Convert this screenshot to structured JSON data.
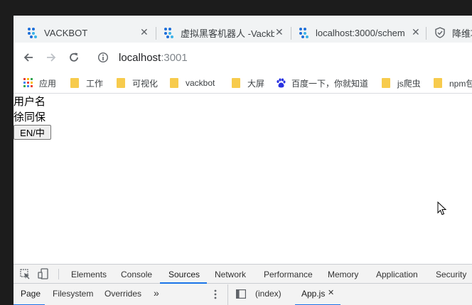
{
  "tabs": [
    {
      "title": "VACKBOT",
      "icon": "vackbot-favicon"
    },
    {
      "title": "虚拟黑客机器人 -Vackbot",
      "icon": "vackbot-favicon"
    },
    {
      "title": "localhost:3000/schem",
      "icon": "vackbot-favicon"
    },
    {
      "title": "降维攻",
      "icon": "shield-favicon"
    }
  ],
  "address": {
    "host": "localhost",
    "port": ":3001"
  },
  "bookmarks": [
    {
      "label": "应用",
      "icon": "apps-grid-icon"
    },
    {
      "label": "工作",
      "icon": "folder-icon"
    },
    {
      "label": "可视化",
      "icon": "folder-icon"
    },
    {
      "label": "vackbot",
      "icon": "folder-icon"
    },
    {
      "label": "大屏",
      "icon": "folder-icon"
    },
    {
      "label": "百度一下，你就知道",
      "icon": "baidu-paw-icon"
    },
    {
      "label": "js爬虫",
      "icon": "folder-icon"
    },
    {
      "label": "npm包",
      "icon": "folder-icon"
    }
  ],
  "page": {
    "username_label": "用户名",
    "username_value": "徐同保",
    "lang_button": "EN/中"
  },
  "devtools": {
    "tabs": [
      "Elements",
      "Console",
      "Sources",
      "Network",
      "Performance",
      "Memory",
      "Application",
      "Security"
    ],
    "active_tab": "Sources",
    "nav_tabs": [
      "Page",
      "Filesystem",
      "Overrides"
    ],
    "more": "»",
    "editor_tabs": [
      "(index)",
      "App.js"
    ]
  },
  "colors": {
    "accent": "#1a73e8",
    "folder": "#f7cb4d",
    "vackbot_blue": "#1e6fd9"
  }
}
